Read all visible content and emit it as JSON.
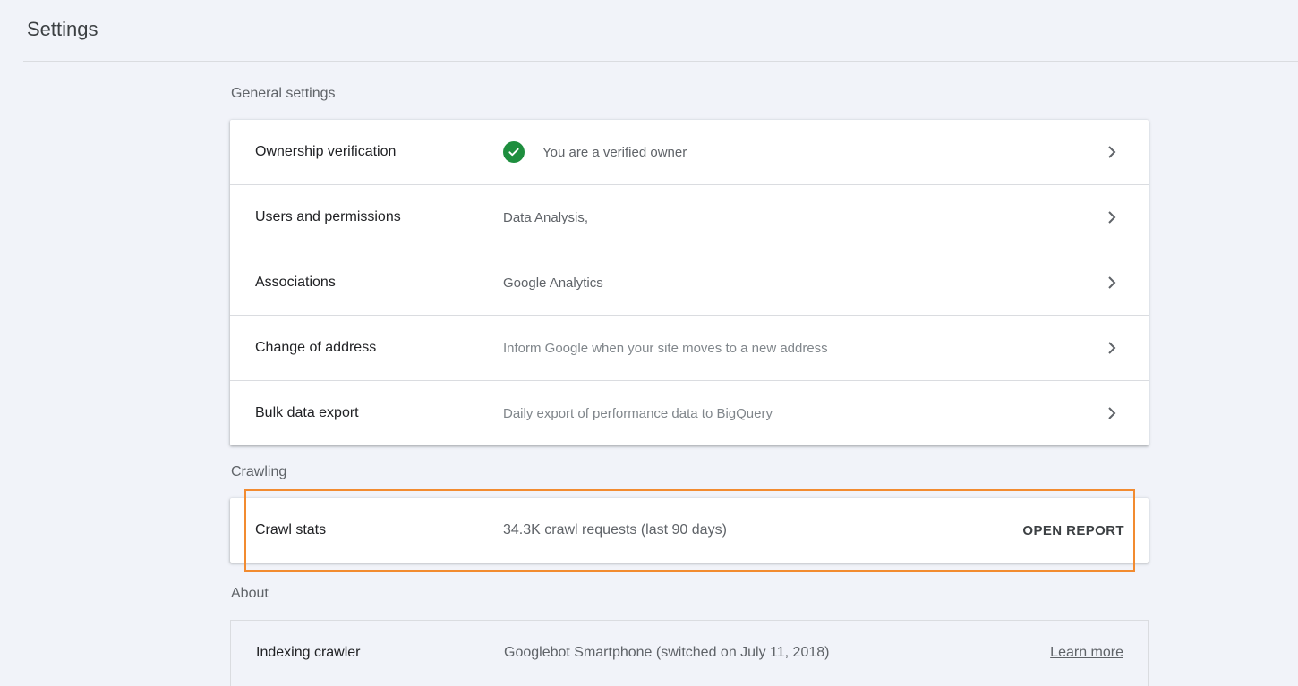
{
  "page": {
    "title": "Settings"
  },
  "sections": {
    "general": {
      "label": "General settings",
      "rows": [
        {
          "label": "Ownership verification",
          "value": "You are a verified owner"
        },
        {
          "label": "Users and permissions",
          "value": "Data Analysis,"
        },
        {
          "label": "Associations",
          "value": "Google Analytics"
        },
        {
          "label": "Change of address",
          "value": "Inform Google when your site moves to a new address"
        },
        {
          "label": "Bulk data export",
          "value": "Daily export of performance data to BigQuery"
        }
      ]
    },
    "crawling": {
      "label": "Crawling",
      "row": {
        "label": "Crawl stats",
        "value": "34.3K crawl requests (last 90 days)",
        "action": "OPEN REPORT"
      }
    },
    "about": {
      "label": "About",
      "row": {
        "label": "Indexing crawler",
        "value": "Googlebot Smartphone (switched on July 11, 2018)",
        "link": "Learn more"
      }
    }
  },
  "icons": {
    "verified": "check-circle-icon",
    "row_nav": "chevron-right-icon"
  },
  "colors": {
    "background": "#f1f3f9",
    "verified_green": "#1e8e3e",
    "highlight": "#f28b30"
  }
}
